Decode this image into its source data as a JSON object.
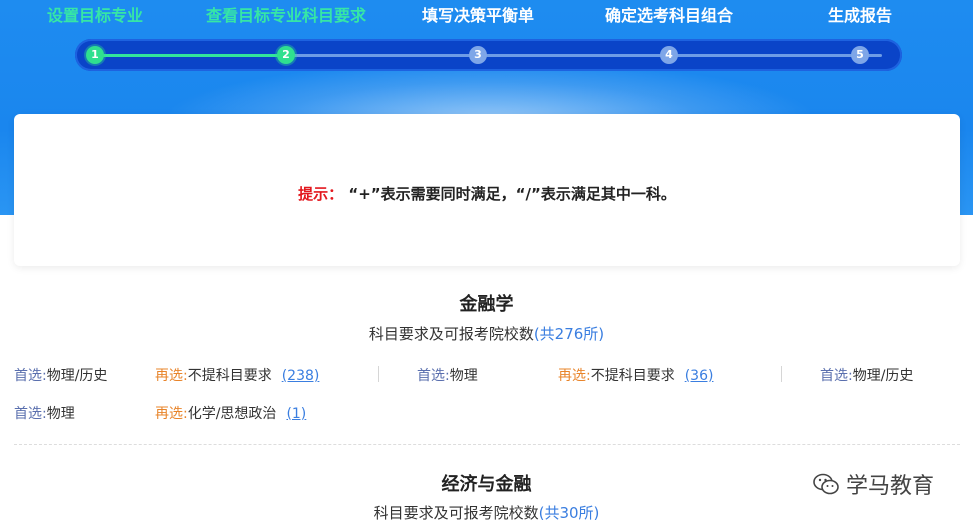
{
  "steps": [
    {
      "label": "设置目标专业",
      "num": "1",
      "state": "done"
    },
    {
      "label": "查看目标专业科目要求",
      "num": "2",
      "state": "done"
    },
    {
      "label": "填写决策平衡单",
      "num": "3",
      "state": "todo"
    },
    {
      "label": "确定选考科目组合",
      "num": "4",
      "state": "todo"
    },
    {
      "label": "生成报告",
      "num": "5",
      "state": "todo"
    }
  ],
  "tip": {
    "label": "提示：",
    "text": "“+”表示需要同时满足，“/”表示满足其中一科。"
  },
  "majors": [
    {
      "name": "金融学",
      "sub_prefix": "科目要求及可报考院校数",
      "sub_count": "(共276所)",
      "groups": [
        {
          "first_key": "首选:",
          "first_val": "物理/历史",
          "second_key": "再选:",
          "second_val": "不提科目要求",
          "count": "(238)"
        },
        {
          "first_key": "首选:",
          "first_val": "物理",
          "second_key": "再选:",
          "second_val": "不提科目要求",
          "count": "(36)"
        },
        {
          "first_key": "首选:",
          "first_val": "物理/历史",
          "second_key": "",
          "second_val": "",
          "count": ""
        },
        {
          "first_key": "首选:",
          "first_val": "物理",
          "second_key": "再选:",
          "second_val": "化学/思想政治",
          "count": "(1)"
        }
      ]
    },
    {
      "name": "经济与金融",
      "sub_prefix": "科目要求及可报考院校数",
      "sub_count": "(共30所)"
    }
  ],
  "watermark": "学马教育",
  "colors": {
    "done": "#36e6a6",
    "accent": "#3a7ee0",
    "tip": "#e3181e",
    "second": "#e8842a"
  }
}
